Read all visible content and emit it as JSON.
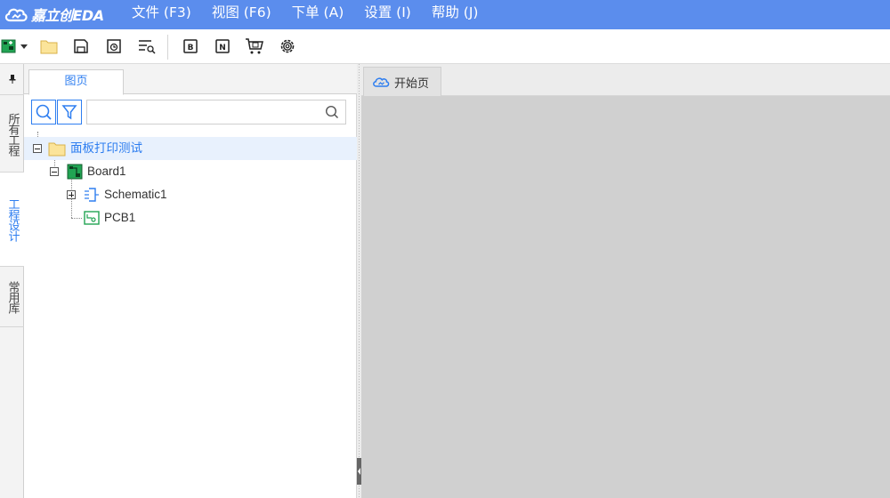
{
  "app": {
    "logo_text": "嘉立创EDA"
  },
  "menu": {
    "items": [
      {
        "label": "文件 (F3)"
      },
      {
        "label": "视图 (F6)"
      },
      {
        "label": "下单 (A)"
      },
      {
        "label": "设置 (I)"
      },
      {
        "label": "帮助 (J)"
      }
    ]
  },
  "toolbar": {
    "icons": [
      "new-project-icon",
      "dropdown-arrow-icon",
      "open-folder-icon",
      "save-icon",
      "save-all-icon",
      "find-icon",
      "bom-icon",
      "netlist-icon",
      "order-cart-icon",
      "settings-gear-icon"
    ]
  },
  "left_tabs": {
    "items": [
      {
        "label": "所有工程",
        "active": false
      },
      {
        "label": "工程设计",
        "active": true
      },
      {
        "label": "常用库",
        "active": false
      }
    ]
  },
  "panel": {
    "tab_label": "图页",
    "search_placeholder": ""
  },
  "tree": {
    "project": {
      "label": "面板打印测试",
      "expanded": true
    },
    "board": {
      "label": "Board1",
      "expanded": true
    },
    "schematic": {
      "label": "Schematic1",
      "expanded": false
    },
    "pcb": {
      "label": "PCB1"
    }
  },
  "documents": {
    "tabs": [
      {
        "label": "开始页",
        "icon": "cloud-icon"
      }
    ]
  },
  "colors": {
    "menubar": "#5b8ded",
    "accent": "#2e7ef0",
    "workspace": "#d0d0d0",
    "folder": "#fbe49a",
    "pcb_green": "#21a453"
  }
}
